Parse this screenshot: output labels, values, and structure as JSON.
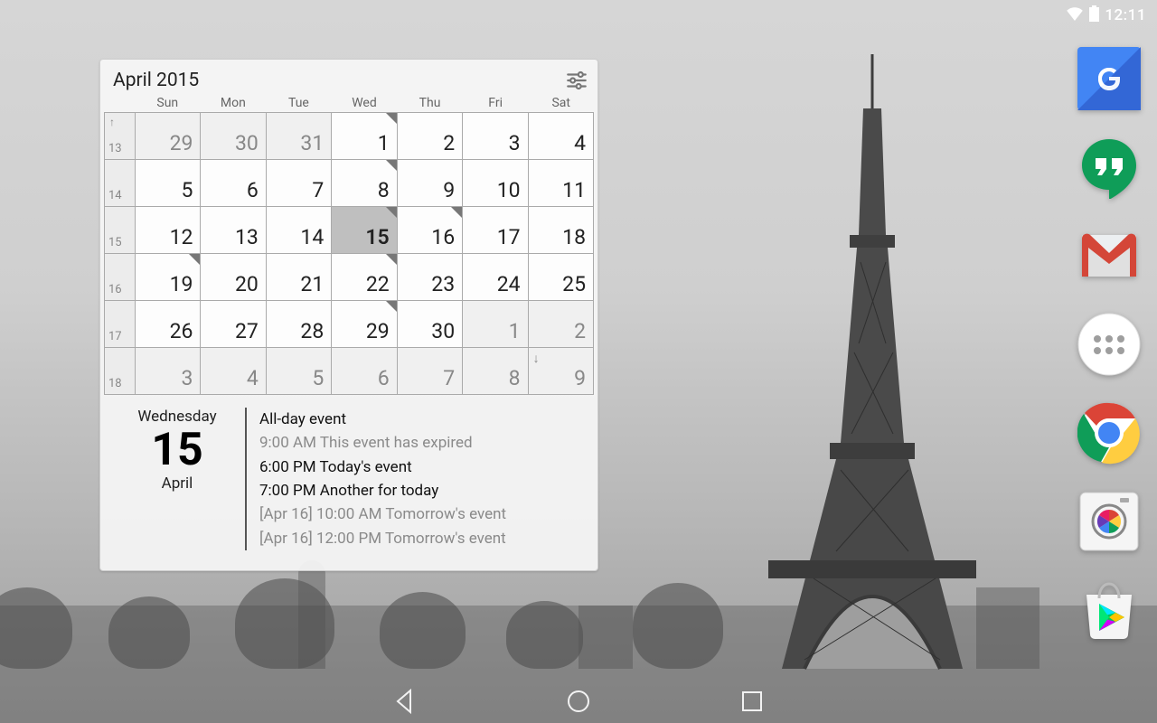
{
  "status": {
    "time": "12:11"
  },
  "apps": [
    {
      "id": "google",
      "name": "Google"
    },
    {
      "id": "hangouts",
      "name": "Hangouts"
    },
    {
      "id": "gmail",
      "name": "Gmail"
    },
    {
      "id": "appdrawer",
      "name": "Apps"
    },
    {
      "id": "chrome",
      "name": "Chrome"
    },
    {
      "id": "camera",
      "name": "Camera"
    },
    {
      "id": "play",
      "name": "Play Store"
    }
  ],
  "widget": {
    "title": "April 2015",
    "dow": [
      "Sun",
      "Mon",
      "Tue",
      "Wed",
      "Thu",
      "Fri",
      "Sat"
    ],
    "weeks": [
      {
        "wk": "13",
        "arrow": "up",
        "days": [
          {
            "n": "29",
            "muted": true
          },
          {
            "n": "30",
            "muted": true
          },
          {
            "n": "31",
            "muted": true
          },
          {
            "n": "1",
            "mark": true
          },
          {
            "n": "2"
          },
          {
            "n": "3"
          },
          {
            "n": "4"
          }
        ]
      },
      {
        "wk": "14",
        "days": [
          {
            "n": "5"
          },
          {
            "n": "6"
          },
          {
            "n": "7"
          },
          {
            "n": "8",
            "mark": true
          },
          {
            "n": "9"
          },
          {
            "n": "10"
          },
          {
            "n": "11"
          }
        ]
      },
      {
        "wk": "15",
        "days": [
          {
            "n": "12"
          },
          {
            "n": "13"
          },
          {
            "n": "14"
          },
          {
            "n": "15",
            "mark": true,
            "today": true
          },
          {
            "n": "16",
            "mark": true
          },
          {
            "n": "17"
          },
          {
            "n": "18"
          }
        ]
      },
      {
        "wk": "16",
        "days": [
          {
            "n": "19",
            "mark": true
          },
          {
            "n": "20"
          },
          {
            "n": "21"
          },
          {
            "n": "22",
            "mark": true
          },
          {
            "n": "23"
          },
          {
            "n": "24"
          },
          {
            "n": "25"
          }
        ]
      },
      {
        "wk": "17",
        "days": [
          {
            "n": "26"
          },
          {
            "n": "27"
          },
          {
            "n": "28"
          },
          {
            "n": "29",
            "mark": true
          },
          {
            "n": "30"
          },
          {
            "n": "1",
            "muted": true
          },
          {
            "n": "2",
            "muted": true
          }
        ]
      },
      {
        "wk": "18",
        "days": [
          {
            "n": "3",
            "muted": true
          },
          {
            "n": "4",
            "muted": true
          },
          {
            "n": "5",
            "muted": true
          },
          {
            "n": "6",
            "muted": true
          },
          {
            "n": "7",
            "muted": true
          },
          {
            "n": "8",
            "muted": true
          },
          {
            "n": "9",
            "muted": true,
            "arrow": "down"
          }
        ]
      }
    ],
    "today": {
      "weekday": "Wednesday",
      "day": "15",
      "month": "April"
    },
    "events": [
      {
        "text": "All-day event",
        "dim": false
      },
      {
        "text": "9:00 AM This event has expired",
        "dim": true
      },
      {
        "text": "6:00 PM Today's event",
        "dim": false
      },
      {
        "text": "7:00 PM Another for today",
        "dim": false
      },
      {
        "text": "[Apr 16] 10:00 AM Tomorrow's event",
        "dim": true
      },
      {
        "text": "[Apr 16] 12:00 PM Tomorrow's event",
        "dim": true
      }
    ]
  }
}
